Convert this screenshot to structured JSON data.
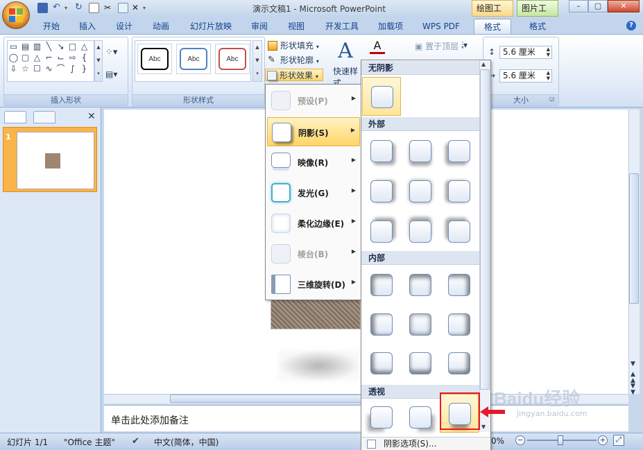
{
  "window": {
    "title": "演示文稿1 - Microsoft PowerPoint",
    "context_tabs": [
      "绘图工具",
      "图片工具"
    ],
    "controls": {
      "minimize": "–",
      "restore": "▢",
      "close": "✕"
    }
  },
  "ribbon": {
    "tabs": [
      {
        "label": "开始"
      },
      {
        "label": "插入"
      },
      {
        "label": "设计"
      },
      {
        "label": "动画"
      },
      {
        "label": "幻灯片放映"
      },
      {
        "label": "审阅"
      },
      {
        "label": "视图"
      },
      {
        "label": "开发工具"
      },
      {
        "label": "加载项"
      },
      {
        "label": "WPS PDF"
      },
      {
        "label": "格式"
      },
      {
        "label": "格式"
      }
    ],
    "active_tab_index": 10,
    "groups": {
      "insert_shapes": "插入形状",
      "shape_styles": "形状样式",
      "size": "大小"
    },
    "shape_styles_previews": [
      "Abc",
      "Abc",
      "Abc"
    ],
    "style_preview_colors": [
      "#000000",
      "#4f81bd",
      "#c0504d"
    ],
    "shape_commands": {
      "fill": "形状填充",
      "outline": "形状轮廓",
      "effects": "形状效果"
    },
    "quick_styles": "快速样式",
    "arrange": {
      "bring_front": "置于顶层"
    },
    "size_fields": {
      "height": "5.6 厘米",
      "width": "5.6 厘米"
    }
  },
  "effects_menu": {
    "items": [
      {
        "label": "预设(P)",
        "enabled": false
      },
      {
        "label": "阴影(S)",
        "enabled": true,
        "active": true
      },
      {
        "label": "映像(R)",
        "enabled": true
      },
      {
        "label": "发光(G)",
        "enabled": true
      },
      {
        "label": "柔化边缘(E)",
        "enabled": true
      },
      {
        "label": "棱台(B)",
        "enabled": false
      },
      {
        "label": "三维旋转(D)",
        "enabled": true
      }
    ]
  },
  "shadow_gallery": {
    "sections": {
      "none": "无阴影",
      "outer": "外部",
      "inner": "内部",
      "perspective": "透视"
    },
    "footer": "阴影选项(S)..."
  },
  "notes": {
    "placeholder": "单击此处添加备注"
  },
  "status": {
    "slide": "幻灯片 1/1",
    "theme": "\"Office 主题\"",
    "language": "中文(简体，中国)",
    "zoom": "0%"
  },
  "thumbnail": {
    "number": "1"
  },
  "watermark": {
    "brand": "Baidu经验",
    "url": "jingyan.baidu.com"
  }
}
